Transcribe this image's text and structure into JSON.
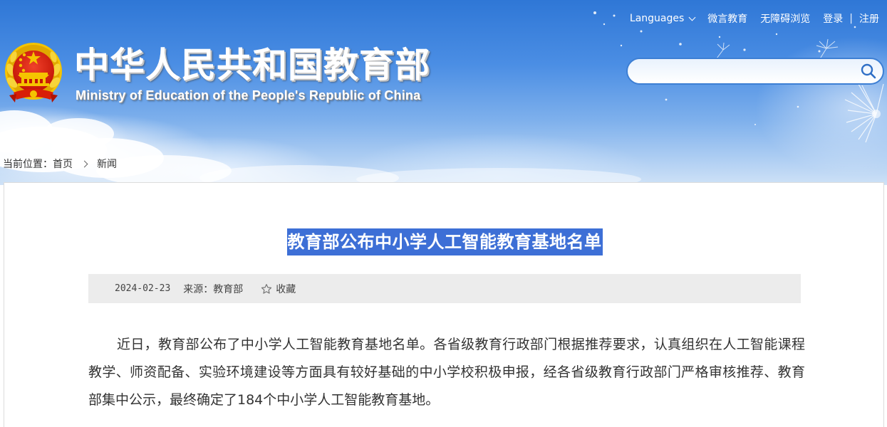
{
  "header": {
    "top_links": {
      "languages": "Languages",
      "wechat": "微言教育",
      "accessible": "无障碍浏览",
      "login": "登录",
      "separator": "|",
      "register": "注册"
    },
    "title_cn": "中华人民共和国教育部",
    "title_en": "Ministry of Education of the People's Republic of China",
    "emblem_icon": "national-emblem-icon",
    "search": {
      "placeholder": "",
      "icon": "search-icon"
    }
  },
  "breadcrumb": {
    "prefix": "当前位置：",
    "home": "首页",
    "current": "新闻"
  },
  "article": {
    "title": "教育部公布中小学人工智能教育基地名单",
    "date": "2024-02-23",
    "source": "来源：教育部",
    "favorite": "收藏",
    "body": "近日，教育部公布了中小学人工智能教育基地名单。各省级教育行政部门根据推荐要求，认真组织在人工智能课程教学、师资配备、实验环境建设等方面具有较好基础的中小学校积极申报，经各省级教育行政部门严格审核推荐、教育部集中公示，最终确定了184个中小学人工智能教育基地。"
  },
  "colors": {
    "title_highlight": "#3d6fd6",
    "header_blue": "#2f77d6",
    "meta_bar": "#ececec",
    "emblem_red": "#d81e06",
    "emblem_gold": "#f5c400"
  }
}
